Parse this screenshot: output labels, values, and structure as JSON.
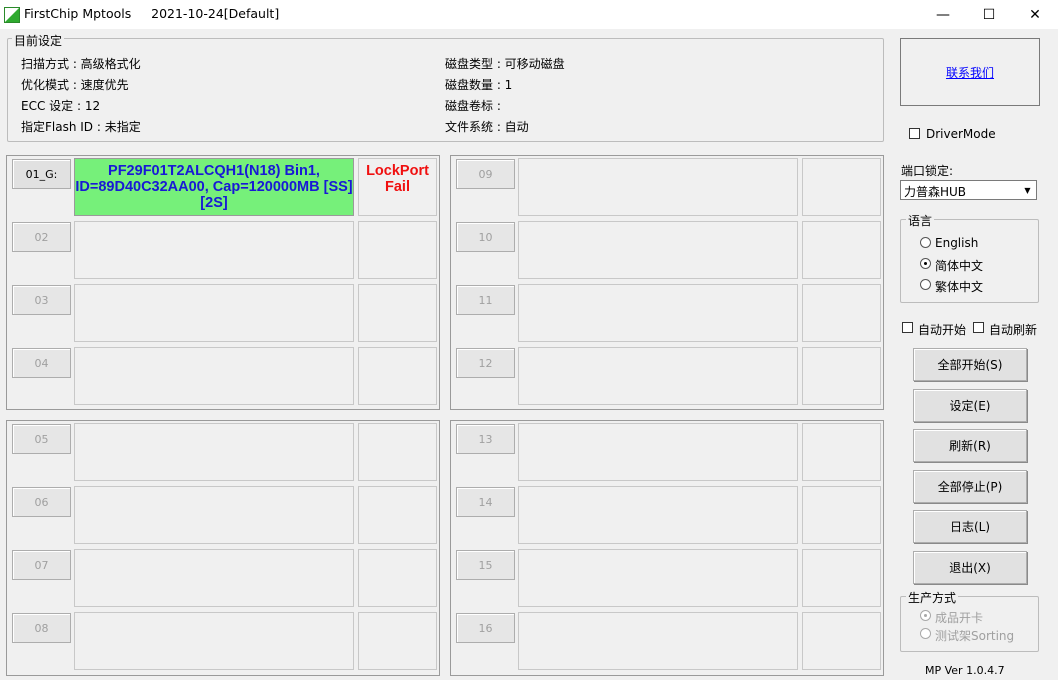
{
  "window": {
    "app_name": "FirstChip Mptools",
    "date_profile": "2021-10-24[Default]",
    "minimize": "—",
    "maximize": "☐",
    "close": "✕"
  },
  "settings": {
    "legend": "目前设定",
    "scan_mode": "扫描方式 : 高级格式化",
    "optimize_mode": "优化模式 : 速度优先",
    "ecc": "ECC 设定 : 12",
    "flash_id": "指定Flash ID : 未指定",
    "disk_type": "磁盘类型 : 可移动磁盘",
    "disk_count": "磁盘数量 : 1",
    "disk_label": "磁盘卷标 :",
    "file_system": "文件系统 : 自动"
  },
  "ports": [
    {
      "label": "01_G:",
      "info": "PF29F01T2ALCQH1(N18)  Bin1, ID=89D40C32AA00, Cap=120000MB [SS] [2S]",
      "status": "LockPort Fail"
    },
    {
      "label": "02",
      "info": "",
      "status": ""
    },
    {
      "label": "03",
      "info": "",
      "status": ""
    },
    {
      "label": "04",
      "info": "",
      "status": ""
    },
    {
      "label": "05",
      "info": "",
      "status": ""
    },
    {
      "label": "06",
      "info": "",
      "status": ""
    },
    {
      "label": "07",
      "info": "",
      "status": ""
    },
    {
      "label": "08",
      "info": "",
      "status": ""
    },
    {
      "label": "09",
      "info": "",
      "status": ""
    },
    {
      "label": "10",
      "info": "",
      "status": ""
    },
    {
      "label": "11",
      "info": "",
      "status": ""
    },
    {
      "label": "12",
      "info": "",
      "status": ""
    },
    {
      "label": "13",
      "info": "",
      "status": ""
    },
    {
      "label": "14",
      "info": "",
      "status": ""
    },
    {
      "label": "15",
      "info": "",
      "status": ""
    },
    {
      "label": "16",
      "info": "",
      "status": ""
    }
  ],
  "sidebar": {
    "contact_link": "联系我们",
    "driver_mode": "DriverMode",
    "port_lock_label": "端口锁定:",
    "port_lock_value": "力普森HUB",
    "language_legend": "语言",
    "languages": [
      "English",
      "简体中文",
      "繁体中文"
    ],
    "language_selected": "简体中文",
    "auto_start": "自动开始",
    "auto_refresh": "自动刷新",
    "buttons": {
      "start_all": "全部开始(S)",
      "settings": "设定(E)",
      "refresh": "刷新(R)",
      "stop_all": "全部停止(P)",
      "log": "日志(L)",
      "exit": "退出(X)"
    },
    "production_legend": "生产方式",
    "production_modes": [
      "成品开卡",
      "测试架Sorting"
    ],
    "version": "MP Ver 1.0.4.7"
  }
}
